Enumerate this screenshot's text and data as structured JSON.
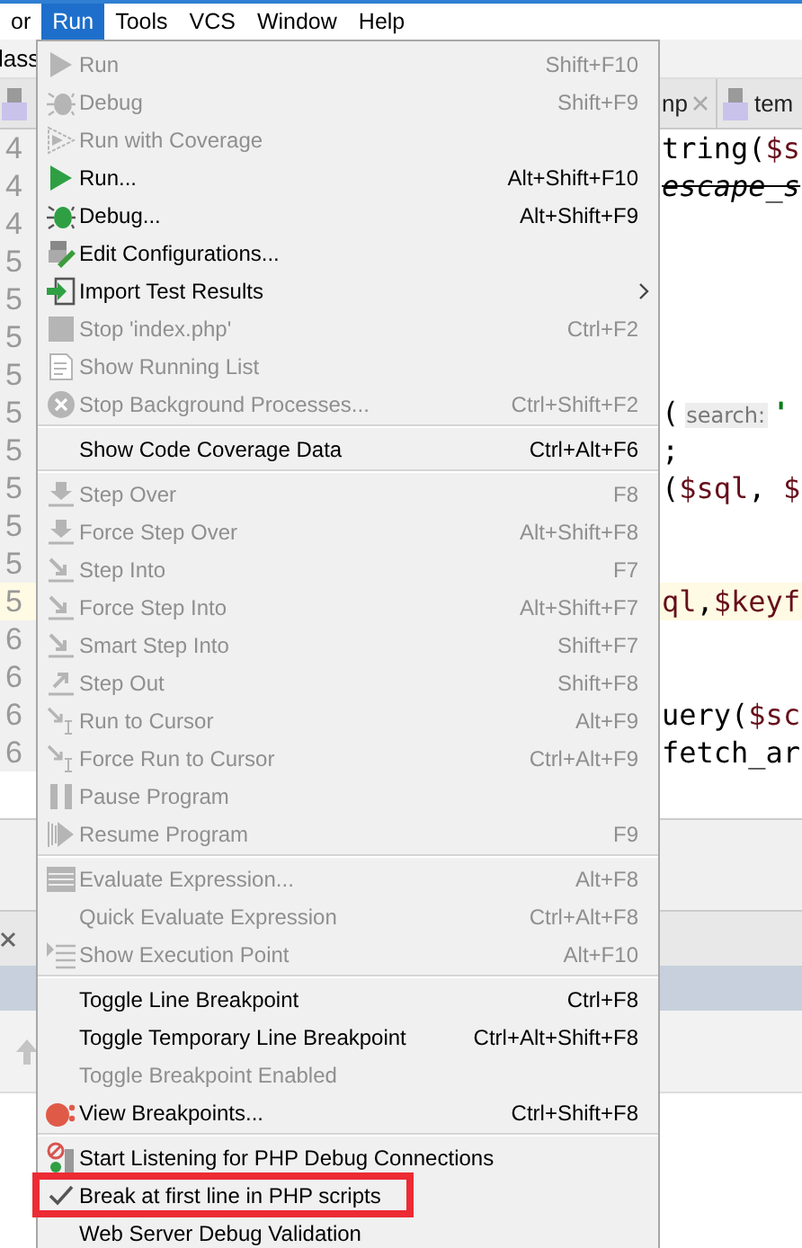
{
  "menubar": {
    "items": [
      {
        "label": "or",
        "selected": false
      },
      {
        "label": "Run",
        "selected": true
      },
      {
        "label": "Tools",
        "selected": false
      },
      {
        "label": "VCS",
        "selected": false
      },
      {
        "label": "Window",
        "selected": false
      },
      {
        "label": "Help",
        "selected": false
      }
    ]
  },
  "toolbar": {
    "text": "lass"
  },
  "editor_tabs": [
    {
      "label": "np",
      "closable": true
    },
    {
      "label": "tem",
      "closable": false
    }
  ],
  "bottom_panel": {
    "header": true
  },
  "editor": {
    "lines": [
      {
        "number": "4",
        "current": false,
        "code": [
          {
            "text": "tring(",
            "kind": "plain"
          },
          {
            "text": "$s",
            "kind": "var"
          }
        ]
      },
      {
        "number": "4",
        "current": false,
        "code": [
          {
            "text": "escape_s",
            "kind": "deprecated"
          }
        ]
      },
      {
        "number": "4",
        "current": false
      },
      {
        "number": "5",
        "current": false
      },
      {
        "number": "5",
        "current": false
      },
      {
        "number": "5",
        "current": false
      },
      {
        "number": "5",
        "current": false
      },
      {
        "number": "5",
        "current": false,
        "code": [
          {
            "text": "(",
            "kind": "plain"
          },
          {
            "text": "search:",
            "kind": "hint"
          },
          {
            "text": "'",
            "kind": "string"
          }
        ]
      },
      {
        "number": "5",
        "current": false,
        "code": [
          {
            "text": ";",
            "kind": "plain"
          }
        ]
      },
      {
        "number": "5",
        "current": false,
        "code": [
          {
            "text": "(",
            "kind": "plain"
          },
          {
            "text": "$sql",
            "kind": "var"
          },
          {
            "text": ", ",
            "kind": "plain"
          },
          {
            "text": "$",
            "kind": "var"
          }
        ]
      },
      {
        "number": "5",
        "current": false
      },
      {
        "number": "5",
        "current": false
      },
      {
        "number": "5",
        "current": true,
        "code": [
          {
            "text": "ql",
            "kind": "var"
          },
          {
            "text": ",",
            "kind": "plain"
          },
          {
            "text": "$keyf",
            "kind": "var"
          }
        ]
      },
      {
        "number": "6",
        "current": false
      },
      {
        "number": "6",
        "current": false
      },
      {
        "number": "6",
        "current": false,
        "code": [
          {
            "text": "uery(",
            "kind": "plain"
          },
          {
            "text": "$sc",
            "kind": "var"
          }
        ]
      },
      {
        "number": "6",
        "current": false,
        "code": [
          {
            "text": "fetch_ar",
            "kind": "plain"
          }
        ]
      }
    ]
  },
  "run_menu": {
    "items": [
      {
        "kind": "item",
        "label": "Run",
        "shortcut": "Shift+F10",
        "disabled": true
      },
      {
        "kind": "item",
        "label": "Debug",
        "shortcut": "Shift+F9",
        "disabled": true
      },
      {
        "kind": "item",
        "label": "Run with Coverage",
        "disabled": true
      },
      {
        "kind": "item",
        "label": "Run...",
        "shortcut": "Alt+Shift+F10",
        "disabled": false
      },
      {
        "kind": "item",
        "label": "Debug...",
        "shortcut": "Alt+Shift+F9",
        "disabled": false
      },
      {
        "kind": "item",
        "label": "Edit Configurations...",
        "disabled": false
      },
      {
        "kind": "item",
        "label": "Import Test Results",
        "disabled": false,
        "submenu": true
      },
      {
        "kind": "item",
        "label": "Stop 'index.php'",
        "shortcut": "Ctrl+F2",
        "disabled": true
      },
      {
        "kind": "item",
        "label": "Show Running List",
        "disabled": true
      },
      {
        "kind": "item",
        "label": "Stop Background Processes...",
        "shortcut": "Ctrl+Shift+F2",
        "disabled": true
      },
      {
        "kind": "separator"
      },
      {
        "kind": "item",
        "label": "Show Code Coverage Data",
        "shortcut": "Ctrl+Alt+F6",
        "disabled": false
      },
      {
        "kind": "separator"
      },
      {
        "kind": "item",
        "label": "Step Over",
        "shortcut": "F8",
        "disabled": true
      },
      {
        "kind": "item",
        "label": "Force Step Over",
        "shortcut": "Alt+Shift+F8",
        "disabled": true
      },
      {
        "kind": "item",
        "label": "Step Into",
        "shortcut": "F7",
        "disabled": true
      },
      {
        "kind": "item",
        "label": "Force Step Into",
        "shortcut": "Alt+Shift+F7",
        "disabled": true
      },
      {
        "kind": "item",
        "label": "Smart Step Into",
        "shortcut": "Shift+F7",
        "disabled": true
      },
      {
        "kind": "item",
        "label": "Step Out",
        "shortcut": "Shift+F8",
        "disabled": true
      },
      {
        "kind": "item",
        "label": "Run to Cursor",
        "shortcut": "Alt+F9",
        "disabled": true
      },
      {
        "kind": "item",
        "label": "Force Run to Cursor",
        "shortcut": "Ctrl+Alt+F9",
        "disabled": true
      },
      {
        "kind": "item",
        "label": "Pause Program",
        "disabled": true
      },
      {
        "kind": "item",
        "label": "Resume Program",
        "shortcut": "F9",
        "disabled": true
      },
      {
        "kind": "separator"
      },
      {
        "kind": "item",
        "label": "Evaluate Expression...",
        "shortcut": "Alt+F8",
        "disabled": true
      },
      {
        "kind": "item",
        "label": "Quick Evaluate Expression",
        "shortcut": "Ctrl+Alt+F8",
        "disabled": true
      },
      {
        "kind": "item",
        "label": "Show Execution Point",
        "shortcut": "Alt+F10",
        "disabled": true
      },
      {
        "kind": "separator"
      },
      {
        "kind": "item",
        "label": "Toggle Line Breakpoint",
        "shortcut": "Ctrl+F8",
        "disabled": false
      },
      {
        "kind": "item",
        "label": "Toggle Temporary Line Breakpoint",
        "shortcut": "Ctrl+Alt+Shift+F8",
        "disabled": false
      },
      {
        "kind": "item",
        "label": "Toggle Breakpoint Enabled",
        "disabled": true
      },
      {
        "kind": "item",
        "label": "View Breakpoints...",
        "shortcut": "Ctrl+Shift+F8",
        "disabled": false
      },
      {
        "kind": "separator"
      },
      {
        "kind": "item",
        "label": "Start Listening for PHP Debug Connections",
        "disabled": false
      },
      {
        "kind": "item",
        "label": "Break at first line in PHP scripts",
        "disabled": false,
        "checked": true,
        "highlighted": true
      },
      {
        "kind": "item",
        "label": "Web Server Debug Validation",
        "disabled": false
      }
    ]
  }
}
